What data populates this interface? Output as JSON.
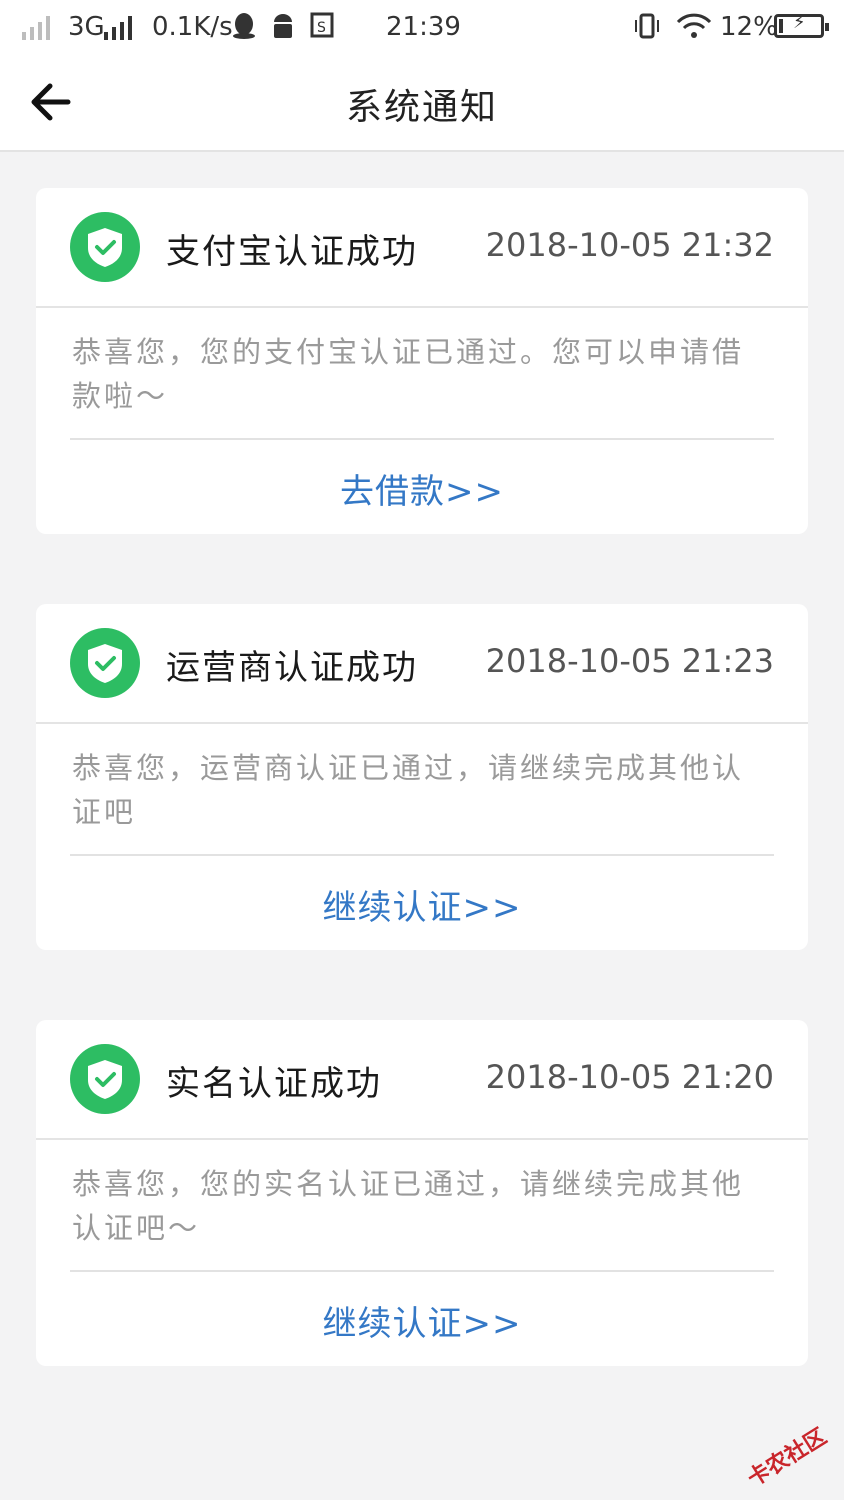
{
  "status_bar": {
    "network_type": "3G",
    "speed": "0.1K/s",
    "time": "21:39",
    "battery": "12%",
    "icons": [
      "signal-icon",
      "qq-icon",
      "android-icon",
      "sim-icon",
      "vibrate-icon",
      "wifi-icon",
      "battery-icon"
    ]
  },
  "header": {
    "title": "系统通知",
    "back_icon": "arrow-left-icon"
  },
  "notifications": [
    {
      "title": "支付宝认证成功",
      "time": "2018-10-05 21:32",
      "body": "恭喜您，您的支付宝认证已通过。您可以申请借款啦～",
      "action": "去借款>>"
    },
    {
      "title": "运营商认证成功",
      "time": "2018-10-05 21:23",
      "body": "恭喜您，运营商认证已通过，请继续完成其他认证吧",
      "action": "继续认证>>"
    },
    {
      "title": "实名认证成功",
      "time": "2018-10-05 21:20",
      "body": "恭喜您，您的实名认证已通过，请继续完成其他认证吧～",
      "action": "继续认证>>"
    }
  ],
  "watermark": "卡农社区",
  "colors": {
    "accent_link": "#3478c6",
    "badge_green": "#2dbd63",
    "background": "#f3f3f4"
  }
}
